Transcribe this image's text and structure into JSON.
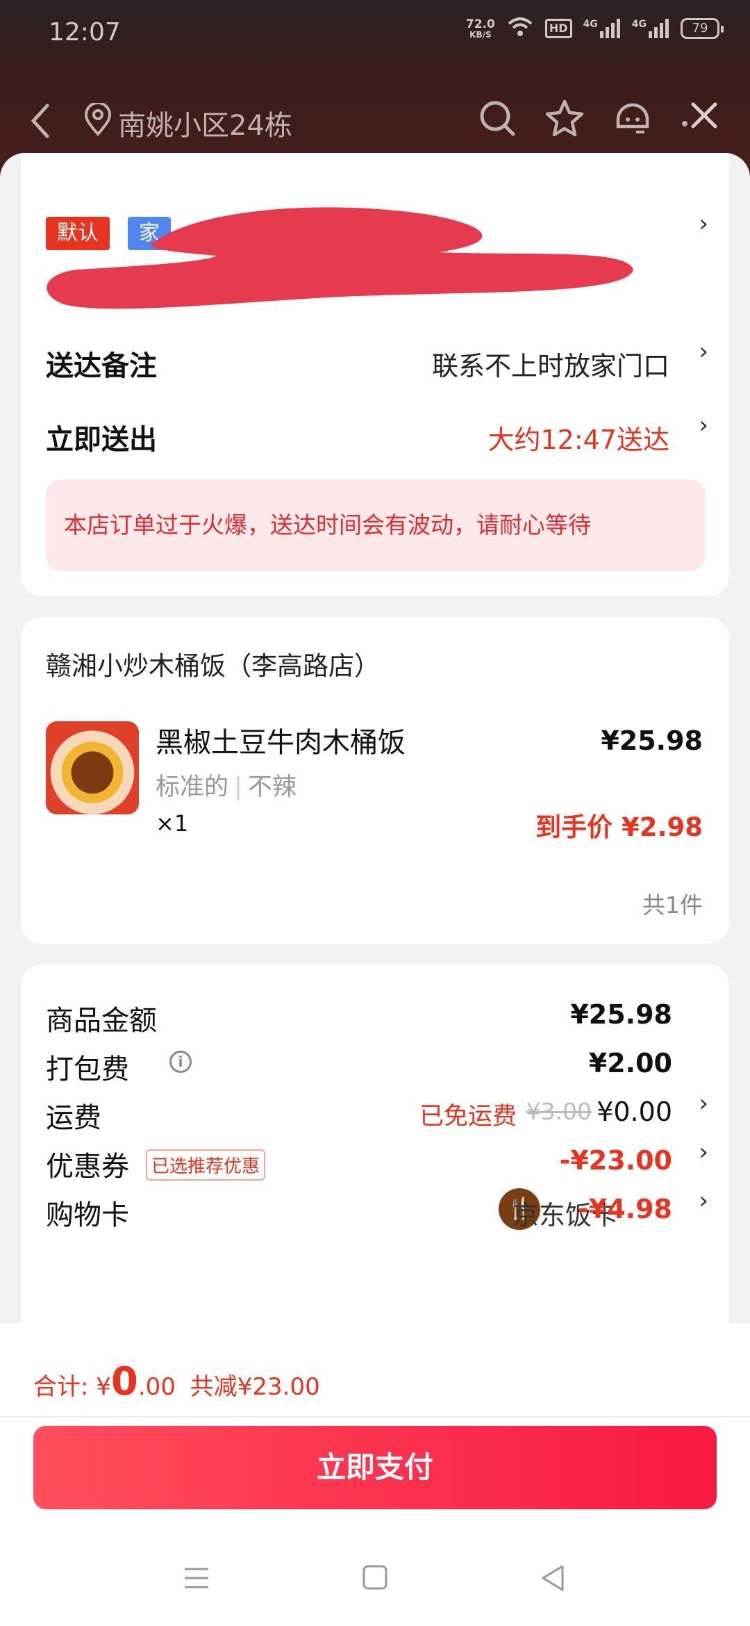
{
  "status_bar": {
    "time": "12:07",
    "net_speed_value": "72.0",
    "net_speed_unit": "KB/S",
    "hd_label": "HD",
    "signal1_label": "4G",
    "signal2_label": "4G",
    "battery": "79"
  },
  "nav": {
    "location": "南姚小区24栋",
    "icons": [
      "back-icon",
      "location-pin-icon",
      "search-icon",
      "star-icon",
      "customer-service-icon",
      "more-icon",
      "close-icon"
    ]
  },
  "address": {
    "tag_default": "默认",
    "tag_home": "家"
  },
  "delivery": {
    "note_label": "送达备注",
    "note_value": "联系不上时放家门口",
    "time_label": "立即送出",
    "time_value": "大约12:47送达",
    "notice": "本店订单过于火爆，送达时间会有波动，请耐心等待"
  },
  "store": {
    "name": "赣湘小炒木桶饭（李高路店）",
    "item": {
      "title": "黑椒土豆牛肉木桶饭",
      "spec1": "标准的",
      "spec_sep": "|",
      "spec2": "不辣",
      "qty": "×1",
      "price": "¥25.98",
      "final_price": "到手价 ¥2.98"
    },
    "count": "共1件"
  },
  "bill": {
    "goods_label": "商品金额",
    "goods_value": "¥25.98",
    "pack_label": "打包费",
    "pack_value": "¥2.00",
    "ship_label": "运费",
    "ship_note": "已免运费",
    "ship_original": "¥3.00",
    "ship_value": "¥0.00",
    "coupon_label": "优惠券",
    "coupon_badge": "已选推荐优惠",
    "coupon_value": "-¥23.00",
    "card_label": "购物卡",
    "card_name": "京东饭卡",
    "card_value": "-¥4.98"
  },
  "footer": {
    "total_prefix": "合计: ¥",
    "total_int": "0",
    "total_dec": ".00",
    "saved": "共减¥23.00",
    "pay_button": "立即支付"
  },
  "colors": {
    "accent_red": "#e8341f",
    "tag_blue": "#4f86f0",
    "pay_gradient_start": "#ff4e5d",
    "pay_gradient_end": "#f8193f"
  }
}
